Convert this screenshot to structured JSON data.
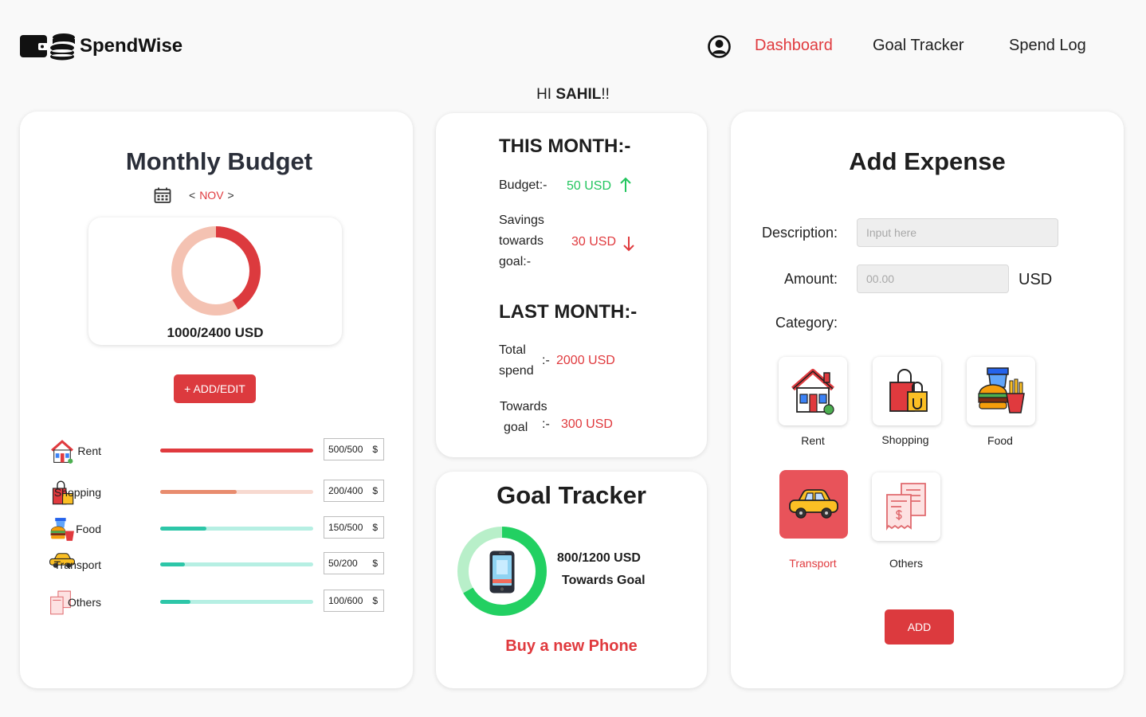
{
  "app": {
    "name": "SpendWise"
  },
  "nav": {
    "items": [
      "Dashboard",
      "Goal Tracker",
      "Spend Log"
    ],
    "active": "Dashboard"
  },
  "greeting": {
    "prefix": "HI ",
    "name": "SAHIL",
    "suffix": "!!"
  },
  "monthly_budget": {
    "title": "Monthly Budget",
    "prev": "<",
    "month": "NOV",
    "next": ">",
    "total_text": "1000/2400  USD",
    "spent_fraction": 0.4167,
    "add_edit_label": "+ ADD/EDIT",
    "categories": [
      {
        "label": "Rent",
        "amount": "500/500",
        "currency": "$",
        "fraction": 1.0,
        "color": "#e03a3e",
        "track": "#f6d0cc"
      },
      {
        "label": "Shopping",
        "amount": "200/400",
        "currency": "$",
        "fraction": 0.5,
        "color": "#e88c6e",
        "track": "#f7d9d0"
      },
      {
        "label": "Food",
        "amount": "150/500",
        "currency": "$",
        "fraction": 0.3,
        "color": "#2dc6a8",
        "track": "#b6efe3"
      },
      {
        "label": "Transport",
        "amount": "50/200",
        "currency": "$",
        "fraction": 0.16,
        "color": "#2dc6a8",
        "track": "#b6efe3"
      },
      {
        "label": "Others",
        "amount": "100/600",
        "currency": "$",
        "fraction": 0.2,
        "color": "#2dc6a8",
        "track": "#b6efe3"
      }
    ]
  },
  "this_month": {
    "heading": "THIS MONTH:-",
    "budget_label": "Budget:-",
    "budget_value": "50 USD",
    "savings_label_1": "Savings",
    "savings_label_2": "towards",
    "savings_label_3": "goal:-",
    "savings_value": "30 USD"
  },
  "last_month": {
    "heading": "LAST MONTH:-",
    "total_label_1": "Total",
    "total_label_2": "spend",
    "sep": ":-",
    "total_value": "2000  USD",
    "towards_label_1": "Towards",
    "towards_label_2": "goal",
    "towards_value": "300  USD"
  },
  "goal_tracker": {
    "title": "Goal Tracker",
    "amount": "800/1200  USD",
    "subtitle": "Towards Goal",
    "goal_name": "Buy a new Phone",
    "progress_fraction": 0.667
  },
  "add_expense": {
    "title": "Add Expense",
    "description_label": "Description:",
    "description_placeholder": "Input here",
    "amount_label": "Amount:",
    "amount_placeholder": "00.00",
    "currency": "USD",
    "category_label": "Category:",
    "categories": [
      "Rent",
      "Shopping",
      "Food",
      "Transport",
      "Others"
    ],
    "selected_category": "Transport",
    "add_label": "ADD"
  },
  "colors": {
    "accent": "#e03a3e",
    "green": "#22c55e",
    "teal": "#2dc6a8"
  }
}
